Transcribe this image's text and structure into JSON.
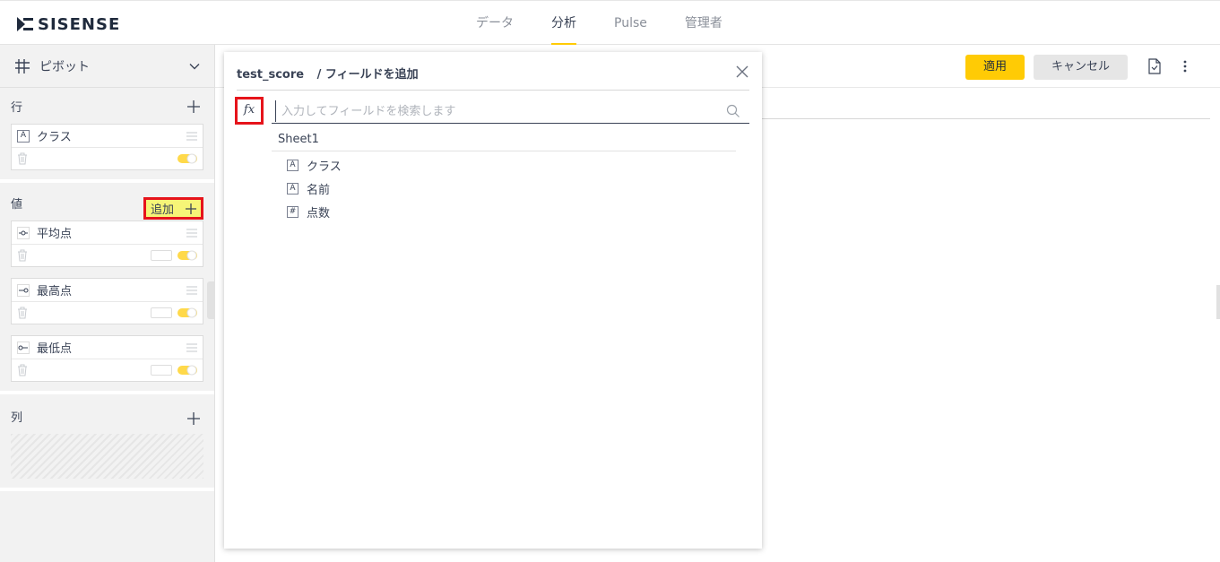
{
  "brand": {
    "logo_text": "SISENSE"
  },
  "nav": {
    "items": [
      {
        "label": "データ",
        "active": false
      },
      {
        "label": "分析",
        "active": true
      },
      {
        "label": "Pulse",
        "active": false
      },
      {
        "label": "管理者",
        "active": false
      }
    ]
  },
  "left_panel": {
    "pivot_label": "ピボット",
    "rows": {
      "title": "行",
      "fields": [
        {
          "label": "クラス",
          "type_icon": "A"
        }
      ]
    },
    "values": {
      "title": "値",
      "add_label": "追加",
      "fields": [
        {
          "label": "平均点",
          "icon": "avg-icon"
        },
        {
          "label": "最高点",
          "icon": "max-icon"
        },
        {
          "label": "最低点",
          "icon": "min-icon"
        }
      ]
    },
    "columns": {
      "title": "列"
    }
  },
  "toolbar": {
    "apply_label": "適用",
    "cancel_label": "キャンセル"
  },
  "dialog": {
    "datasource": "test_score",
    "title": "/ フィールドを追加",
    "fx_label": "fx",
    "search_placeholder": "入力してフィールドを検索します",
    "sheet_name": "Sheet1",
    "fields": [
      {
        "type": "A",
        "label": "クラス"
      },
      {
        "type": "A",
        "label": "名前"
      },
      {
        "type": "#",
        "label": "点数"
      }
    ]
  },
  "colors": {
    "accent": "#ffcb05",
    "highlight": "#e6141b",
    "add_bg": "#f6f577"
  }
}
